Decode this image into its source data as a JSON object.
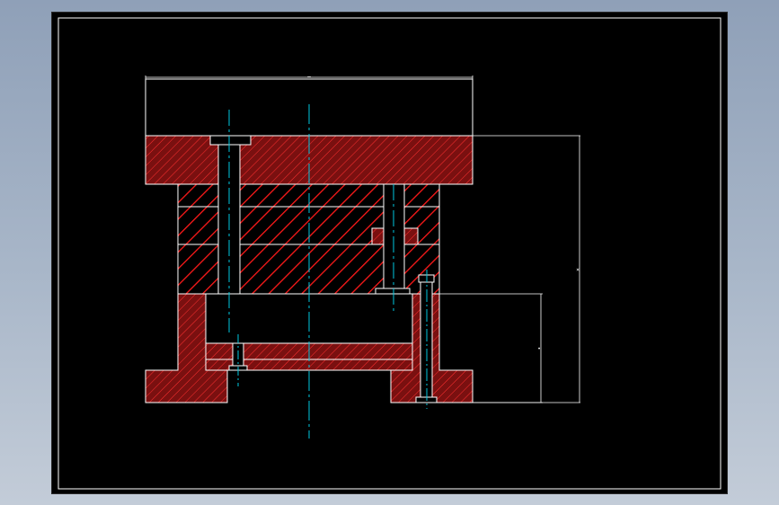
{
  "colors": {
    "background": "#000000",
    "outline": "#ffffff",
    "hatch": "#ff2020",
    "centerline": "#00c8e0",
    "window_gradient_top": "#8fa0b8",
    "window_gradient_bottom": "#c3ccd8"
  },
  "dimensions": {
    "top_width": "–",
    "total_height": "×",
    "lower_height": "•"
  }
}
